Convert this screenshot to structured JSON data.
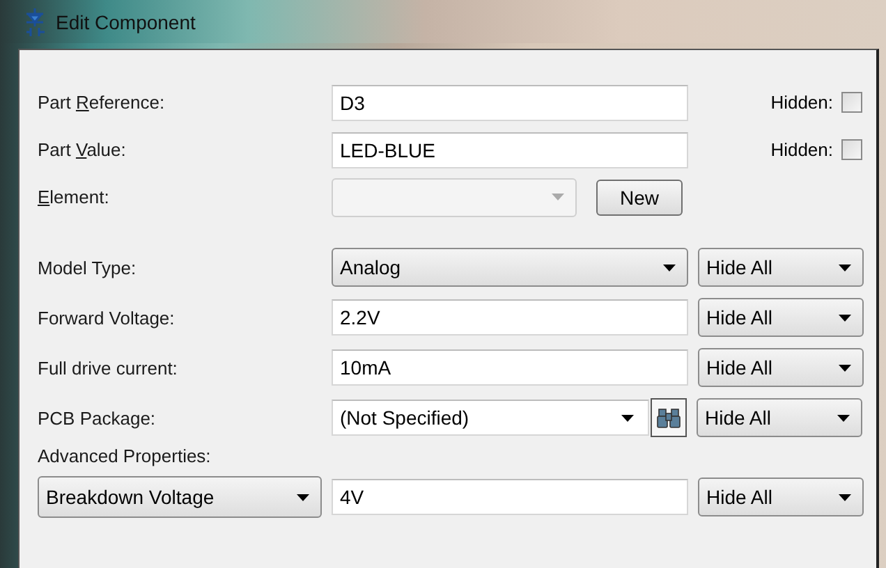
{
  "window": {
    "title": "Edit Component"
  },
  "identity": [
    {
      "label": {
        "before": "Part ",
        "key": "R",
        "after": "eference:"
      },
      "value": "D3",
      "hidden_label": "Hidden:",
      "hidden": false
    },
    {
      "label": {
        "before": "Part ",
        "key": "V",
        "after": "alue:"
      },
      "value": "LED-BLUE",
      "hidden_label": "Hidden:",
      "hidden": false
    }
  ],
  "element": {
    "label": {
      "key": "E",
      "after": "lement:"
    },
    "disabled": true,
    "button": "New"
  },
  "properties": [
    {
      "kind": "select",
      "label": "Model Type:",
      "value": "Analog",
      "visibility": "Hide All"
    },
    {
      "kind": "text",
      "label": "Forward Voltage:",
      "value": "2.2V",
      "visibility": "Hide All"
    },
    {
      "kind": "text",
      "label": "Full drive current:",
      "value": "10mA",
      "visibility": "Hide All"
    },
    {
      "kind": "package",
      "label": "PCB Package:",
      "value": "(Not Specified)",
      "visibility": "Hide All"
    }
  ],
  "advanced": {
    "label": "Advanced Properties:",
    "property": "Breakdown Voltage",
    "value": "4V",
    "visibility": "Hide All"
  }
}
